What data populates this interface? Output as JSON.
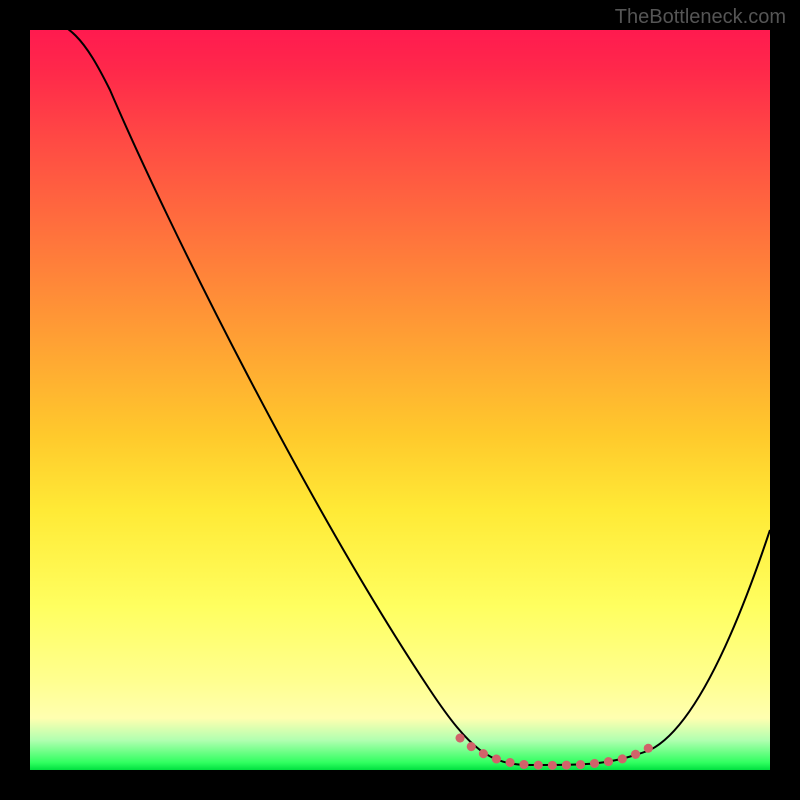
{
  "watermark": "TheBottleneck.com",
  "chart_data": {
    "type": "line",
    "title": "",
    "xlabel": "",
    "ylabel": "",
    "xlim": [
      0,
      100
    ],
    "ylim": [
      0,
      100
    ],
    "series": [
      {
        "name": "curve",
        "x": [
          0,
          8,
          16,
          24,
          32,
          40,
          48,
          56,
          62,
          66,
          70,
          74,
          78,
          82,
          86,
          90,
          94,
          100
        ],
        "values": [
          102,
          100,
          88,
          73,
          58,
          43,
          28,
          13,
          5,
          2,
          1,
          0.5,
          0.5,
          1,
          3,
          9,
          20,
          40
        ]
      },
      {
        "name": "optimal-zone",
        "x": [
          62,
          66,
          70,
          74,
          78,
          82,
          85
        ],
        "values": [
          5,
          2,
          1,
          0.5,
          0.5,
          1,
          2.5
        ]
      }
    ],
    "gradient_stops": [
      {
        "pos": 0,
        "color": "#ff1a4f"
      },
      {
        "pos": 15,
        "color": "#ff4a44"
      },
      {
        "pos": 35,
        "color": "#ff8a38"
      },
      {
        "pos": 55,
        "color": "#ffca2c"
      },
      {
        "pos": 78,
        "color": "#ffff60"
      },
      {
        "pos": 96,
        "color": "#b0ffb0"
      },
      {
        "pos": 100,
        "color": "#00e040"
      }
    ]
  }
}
